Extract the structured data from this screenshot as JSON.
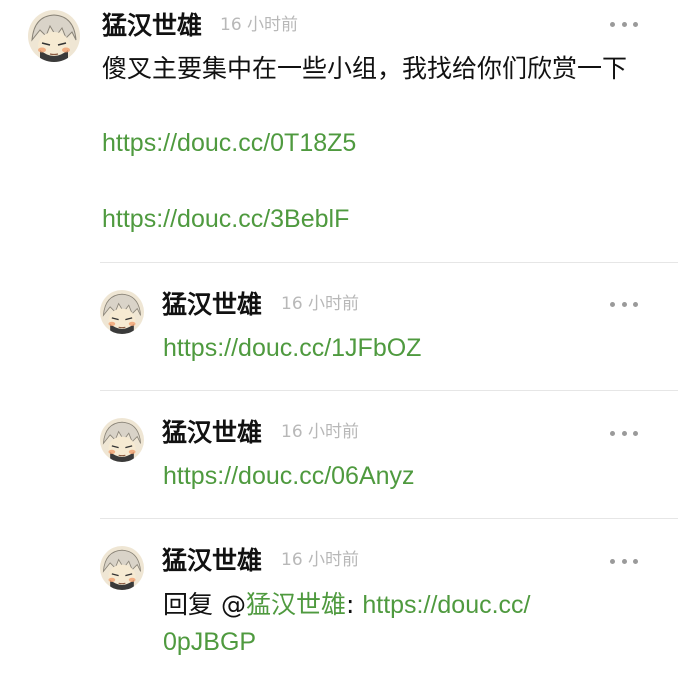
{
  "main_post": {
    "username": "猛汉世雄",
    "time": "16 小时前",
    "text": "傻叉主要集中在一些小组，我找给你们欣赏一下",
    "links": [
      "https://douc.cc/0T18Z5",
      "https://douc.cc/3BeblF"
    ]
  },
  "replies": [
    {
      "username": "猛汉世雄",
      "time": "16 小时前",
      "link": "https://douc.cc/1JFbOZ"
    },
    {
      "username": "猛汉世雄",
      "time": "16 小时前",
      "link": "https://douc.cc/06Anyz"
    },
    {
      "username": "猛汉世雄",
      "time": "16 小时前",
      "reply_prefix": "回复 @",
      "mention": "猛汉世雄",
      "colon": ":",
      "link_line1": "https://douc.cc/",
      "link_line2": "0pJBGP"
    }
  ],
  "icons": {
    "avatar": "avatar-icon",
    "more": "more-options-icon"
  },
  "colors": {
    "link": "#4f9a3f",
    "meta": "#b8b8b8",
    "text": "#111111",
    "divider": "#e6e6e6"
  }
}
